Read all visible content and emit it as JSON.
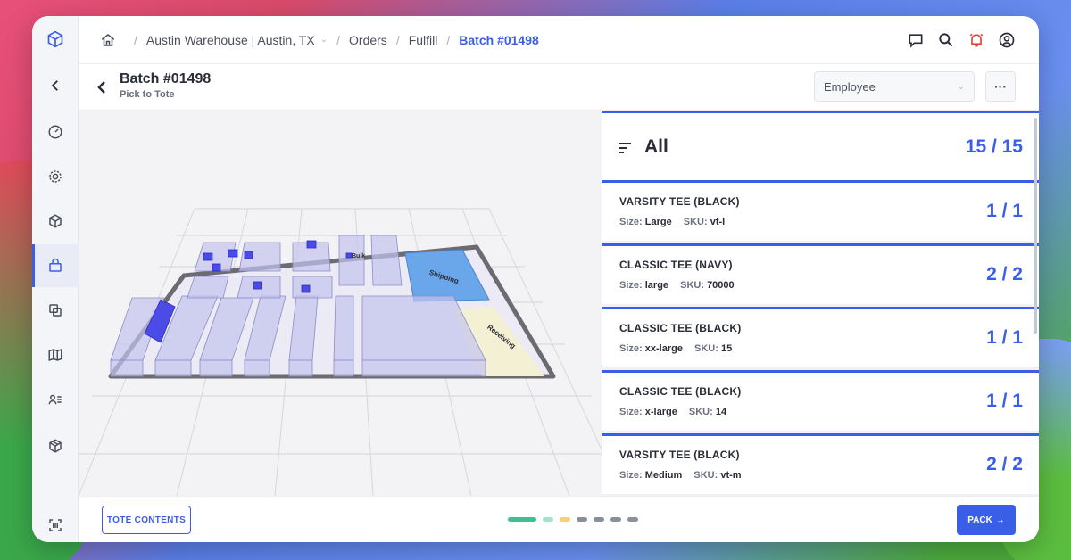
{
  "colors": {
    "accent": "#3b5ee8",
    "sidebar": "#f4f5f8",
    "shelf": "#c8c8f0",
    "shipping": "#5b9ee8",
    "receiving": "#f4f0d4"
  },
  "breadcrumb": {
    "location": "Austin Warehouse | Austin, TX",
    "orders": "Orders",
    "fulfill": "Fulfill",
    "batch": "Batch #01498"
  },
  "header": {
    "title": "Batch #01498",
    "subtitle": "Pick to Tote",
    "employee_placeholder": "Employee",
    "more_label": "···"
  },
  "map": {
    "shipping_label": "Shipping",
    "receiving_label": "Receiving",
    "bulk_label": "Bulk"
  },
  "panel": {
    "all_label": "All",
    "all_count": "15 / 15",
    "size_key": "Size:",
    "sku_key": "SKU:",
    "items": [
      {
        "name": "VARSITY TEE (BLACK)",
        "size": "Large",
        "sku": "vt-l",
        "count": "1 / 1"
      },
      {
        "name": "CLASSIC TEE (NAVY)",
        "size": "large",
        "sku": "70000",
        "count": "2 / 2"
      },
      {
        "name": "CLASSIC TEE (BLACK)",
        "size": "xx-large",
        "sku": "15",
        "count": "1 / 1"
      },
      {
        "name": "CLASSIC TEE (BLACK)",
        "size": "x-large",
        "sku": "14",
        "count": "1 / 1"
      },
      {
        "name": "VARSITY TEE (BLACK)",
        "size": "Medium",
        "sku": "vt-m",
        "count": "2 / 2"
      }
    ]
  },
  "footer": {
    "tote_label": "TOTE CONTENTS",
    "pack_label": "PACK",
    "pack_arrow": "→"
  },
  "sidebar": [
    "cube-logo-icon",
    "collapse-chevron-icon",
    "dashboard-icon",
    "settings-icon",
    "inventory-box-icon",
    "fulfill-bag-icon",
    "transfer-icon",
    "map-icon",
    "users-list-icon",
    "package-icon",
    "barcode-scan-icon"
  ]
}
